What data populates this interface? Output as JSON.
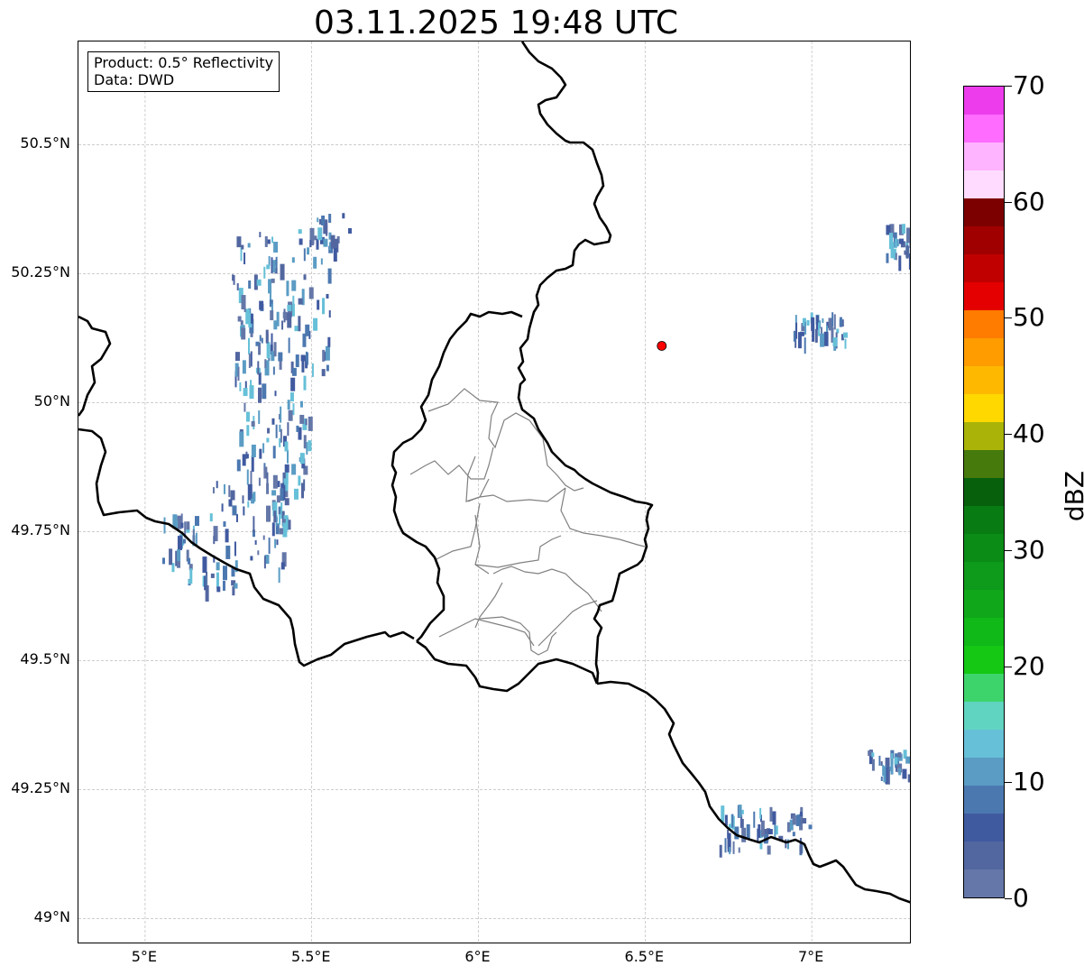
{
  "title": "03.11.2025 19:48 UTC",
  "info_box": {
    "product": "Product: 0.5° Reflectivity",
    "data_source": "Data: DWD"
  },
  "map": {
    "lon_range": [
      4.8,
      7.3
    ],
    "lat_range": [
      48.95,
      50.7
    ],
    "gridlines": true,
    "y_ticks": [
      {
        "value": 50.5,
        "label": "50.5°N"
      },
      {
        "value": 50.25,
        "label": "50.25°N"
      },
      {
        "value": 50.0,
        "label": "50°N"
      },
      {
        "value": 49.75,
        "label": "49.75°N"
      },
      {
        "value": 49.5,
        "label": "49.5°N"
      },
      {
        "value": 49.25,
        "label": "49.25°N"
      },
      {
        "value": 49.0,
        "label": "49°N"
      }
    ],
    "x_ticks": [
      {
        "value": 5.0,
        "label": "5°E"
      },
      {
        "value": 5.5,
        "label": "5.5°E"
      },
      {
        "value": 6.0,
        "label": "6°E"
      },
      {
        "value": 6.5,
        "label": "6.5°E"
      },
      {
        "value": 7.0,
        "label": "7°E"
      }
    ],
    "radar_site": {
      "lon": 6.55,
      "lat": 50.11,
      "color": "#ff0000"
    },
    "border_color": "#000000",
    "district_color": "#808080"
  },
  "colorbar": {
    "label": "dBZ",
    "min": 0,
    "max": 70,
    "ticks": [
      {
        "value": 0,
        "label": "0"
      },
      {
        "value": 10,
        "label": "10"
      },
      {
        "value": 20,
        "label": "20"
      },
      {
        "value": 30,
        "label": "30"
      },
      {
        "value": 40,
        "label": "40"
      },
      {
        "value": 50,
        "label": "50"
      },
      {
        "value": 60,
        "label": "60"
      },
      {
        "value": 70,
        "label": "70"
      }
    ],
    "colors": [
      "#6477a8",
      "#5266a0",
      "#405aa0",
      "#4c78b0",
      "#5a9cc4",
      "#66c0d8",
      "#60d4c0",
      "#3ed46c",
      "#14c814",
      "#10b818",
      "#10a81a",
      "#0e9a1a",
      "#0a8c16",
      "#087c12",
      "#06600c",
      "#467a0c",
      "#aab408",
      "#ffd800",
      "#ffb800",
      "#ff9c00",
      "#ff7c00",
      "#e40000",
      "#c00000",
      "#a00000",
      "#7c0000",
      "#ffdcff",
      "#ffb4ff",
      "#ff6cff",
      "#ec3cec"
    ]
  }
}
